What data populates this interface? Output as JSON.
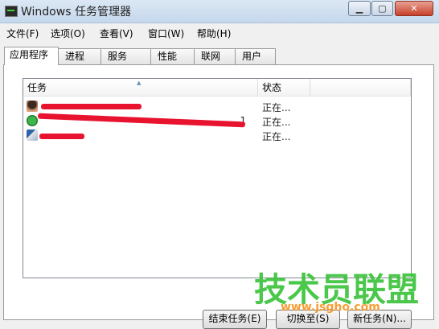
{
  "window": {
    "title": "Windows 任务管理器",
    "controls": {
      "minimize": "▁",
      "maximize": "▢",
      "close": "✕"
    }
  },
  "menu": [
    {
      "label": "文件(F)"
    },
    {
      "label": "选项(O)"
    },
    {
      "label": "查看(V)"
    },
    {
      "label": "窗口(W)"
    },
    {
      "label": "帮助(H)"
    }
  ],
  "tabs": [
    {
      "label": "应用程序",
      "active": true
    },
    {
      "label": "进程",
      "active": false
    },
    {
      "label": "服务",
      "active": false
    },
    {
      "label": "性能",
      "active": false
    },
    {
      "label": "联网",
      "active": false
    },
    {
      "label": "用户",
      "active": false
    }
  ],
  "list": {
    "columns": [
      "任务",
      "状态"
    ],
    "sort_indicator": "▲",
    "rows": [
      {
        "name": "",
        "status": "正在..."
      },
      {
        "name": "...1",
        "status": "正在..."
      },
      {
        "name": "",
        "status": "正在..."
      }
    ]
  },
  "buttons": {
    "end_task": "结束任务(E)",
    "switch_to": "切换至(S)",
    "new_task": "新任务(N)..."
  },
  "watermark": {
    "brand": "技术员联盟",
    "url": "www.jsgho.com"
  }
}
